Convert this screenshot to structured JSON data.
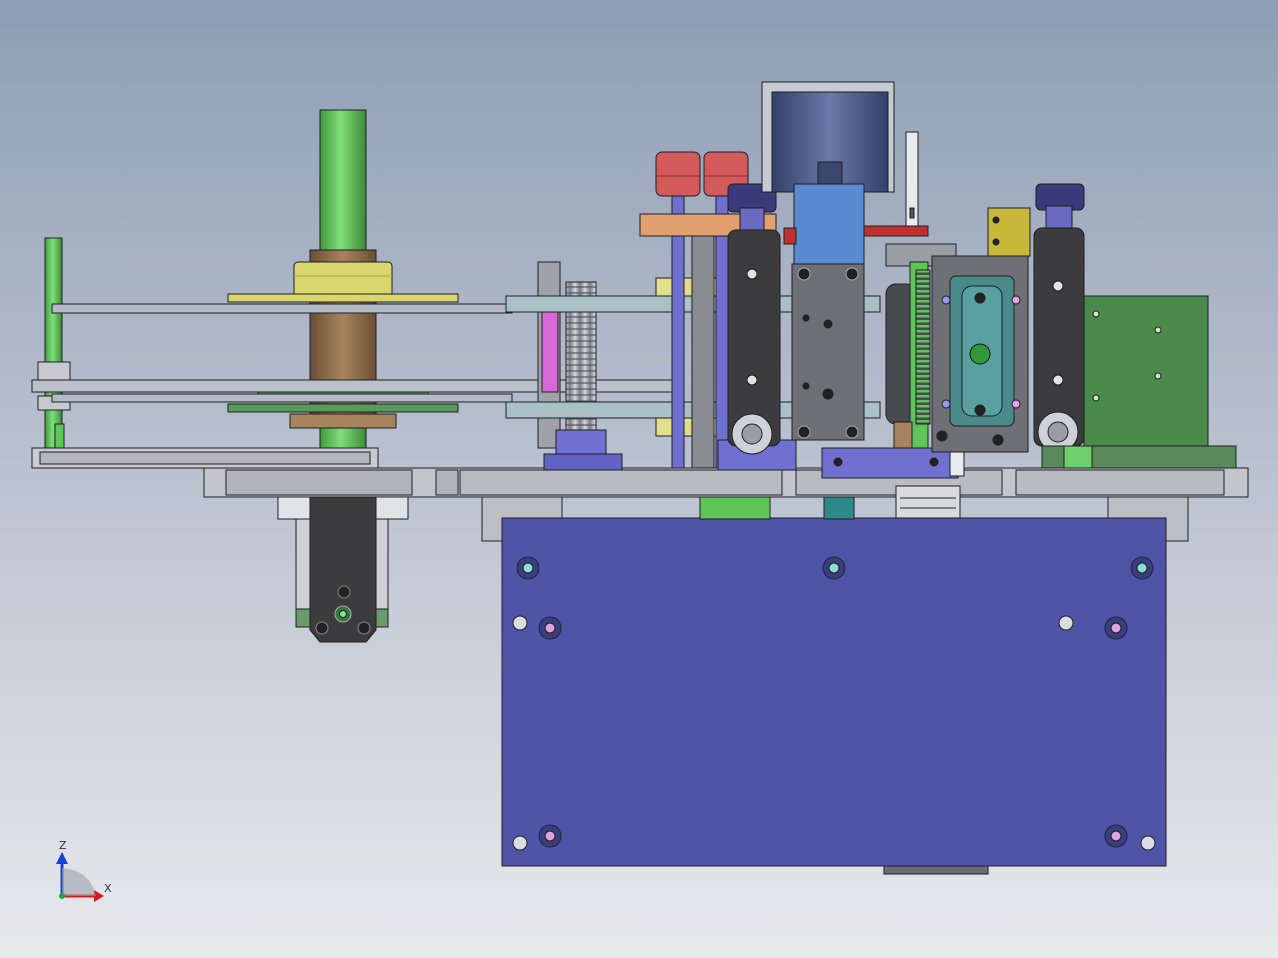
{
  "viewport": {
    "background_top": "#8f9db4",
    "background_bottom": "#e7e9ec"
  },
  "triad": {
    "z_label": "Z",
    "x_label": "X",
    "z_color": "#1a3fd6",
    "x_color": "#d61a1a",
    "y_color": "#1aa64a"
  },
  "colors": {
    "base_plate": "#5054a6",
    "frame_grey": "#b9bcc4",
    "shaft_green": "#5fc45a",
    "bushing_yellow": "#d9d66e",
    "bushing_brown": "#8a6a4a",
    "motor_blue": "#4c5a8c",
    "block_dark": "#3c3c3e",
    "block_grey": "#6e7076",
    "cap_red": "#d25a5a",
    "cap_navy": "#3a3a7a",
    "spring_magenta": "#d868d8",
    "orange_bar": "#e0a070",
    "light_blue": "#5a8ad0",
    "teal_plate": "#4a8a8a",
    "right_green": "#4a8a4a",
    "purple_rod": "#7070d0"
  }
}
